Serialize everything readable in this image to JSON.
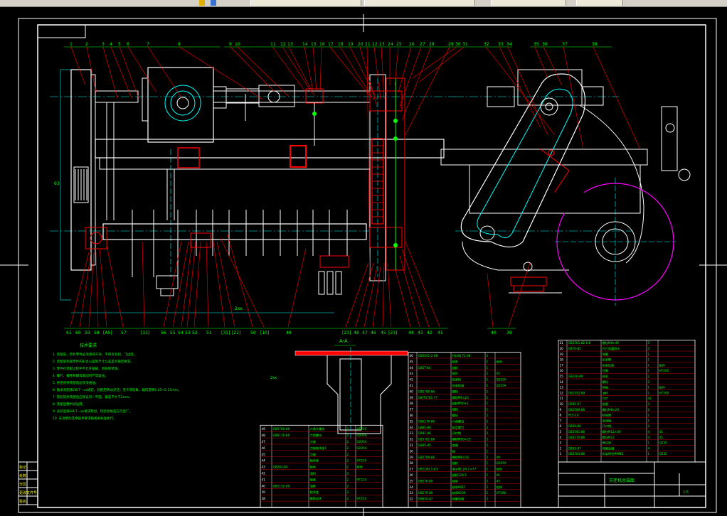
{
  "window": {
    "top_tabs": [
      "",
      "",
      "",
      ""
    ]
  },
  "drawing": {
    "section_label": "A-A",
    "dim_bottom": "2xx",
    "dim_left": "63",
    "dim_mid": "2xx",
    "tech_title": "技术要求",
    "tech_lines": [
      "1. 装配前，所有零件必须清洗干净，不得有毛刺、飞边等。",
      "2. 装配前检查零件的形位公差和尺寸公差是否满足要求。",
      "3. 零件在装配过程中不允许磕碰、划伤和锈蚀。",
      "4. 螺钉、螺栓和螺母紧固时严禁敲击。",
      "5. 各密封件装配前必须浸透油。",
      "6. 轴承装配按GB/T—xx规定，装配后转动灵活，无卡滞现象，轴向游隙0.05~0.15mm。",
      "7. 链轮链条装配后应保证同一平面，偏差不大于2mm。",
      "8. 装配后整机试运转。",
      "9. 总装后按GB/T—xx要求检验，检验合格后方可出厂。",
      "10. 未注明的其余技术要求按相关标准执行。"
    ],
    "top_labels": [
      "1",
      "2",
      "3",
      "4",
      "5",
      "6",
      "7",
      "8",
      "9",
      "10",
      "11",
      "12",
      "13",
      "14",
      "15",
      "16",
      "17",
      "18",
      "19",
      "20",
      "21",
      "22",
      "23",
      "24",
      "25",
      "26",
      "27",
      "28",
      "29",
      "30",
      "31",
      "32",
      "33",
      "34",
      "35",
      "36",
      "37",
      "38"
    ],
    "bottom_labels": [
      "61",
      "60",
      "59",
      "58",
      "[A5]",
      "57",
      "[11]",
      "56",
      "55",
      "54",
      "53",
      "52",
      "51",
      "[31]",
      "[21]",
      "50",
      "[10]",
      "49",
      "[23]",
      "48",
      "47",
      "46",
      "45",
      "[23]",
      "44",
      "43",
      "42",
      "41",
      "40",
      "39"
    ],
    "title_block": {
      "name": "灭茬机总装图",
      "scale": "1:5"
    },
    "bom_left": [
      {
        "no": "49",
        "code": "GB5780-86",
        "name": "六角头螺栓",
        "qty": "2",
        "mat": "HT210"
      },
      {
        "no": "48",
        "code": "GB6170-86",
        "name": "六角螺母",
        "qty": "2",
        "mat": "Q235A"
      },
      {
        "no": "47",
        "code": "",
        "name": "刀座",
        "qty": "2",
        "mat": "Q235A"
      },
      {
        "no": "46",
        "code": "",
        "name": "刀轴轴承座1",
        "qty": "2",
        "mat": "Q235A"
      },
      {
        "no": "45",
        "code": "",
        "name": "刀轴",
        "qty": "2",
        "mat": ""
      },
      {
        "no": "44",
        "code": "",
        "name": "轴承座",
        "qty": "2",
        "mat": "HT210"
      },
      {
        "no": "43",
        "code": "GB281-84",
        "name": "轴承",
        "qty": "2",
        "mat": "组件"
      },
      {
        "no": "42",
        "code": "",
        "name": "油封",
        "qty": "2",
        "mat": ""
      },
      {
        "no": "41",
        "code": "",
        "name": "端盖",
        "qty": "2",
        "mat": "HT210"
      },
      {
        "no": "40",
        "code": "GB1152-89",
        "name": "油杯",
        "qty": "2",
        "mat": ""
      },
      {
        "no": "39",
        "code": "",
        "name": "轴承盖",
        "qty": "2",
        "mat": ""
      },
      {
        "no": "38",
        "code": "",
        "name": "螺栓组件",
        "qty": "2",
        "mat": "HT210"
      }
    ],
    "bom_mid": [
      {
        "no": "46",
        "code": "GB5871-2-88",
        "name": "开口销 72:88",
        "qty": "2",
        "mat": ""
      },
      {
        "no": "45",
        "code": "",
        "name": "链条",
        "qty": "1",
        "mat": "组件"
      },
      {
        "no": "44",
        "code": "GB5T-84",
        "name": "链轮",
        "qty": "1",
        "mat": ""
      },
      {
        "no": "43",
        "code": "",
        "name": "垫片",
        "qty": "2",
        "mat": "45"
      },
      {
        "no": "42",
        "code": "",
        "name": "张紧轮",
        "qty": "1",
        "mat": "Q235A"
      },
      {
        "no": "41",
        "code": "",
        "name": "张紧轮轴",
        "qty": "1",
        "mat": "Q235A"
      },
      {
        "no": "40",
        "code": "GB5780-86",
        "name": "螺栓",
        "qty": "2",
        "mat": ""
      },
      {
        "no": "39",
        "code": "GB/T5781-77",
        "name": "螺栓M6×25",
        "qty": "2",
        "mat": ""
      },
      {
        "no": "38",
        "code": "",
        "name": "链轮M10×1",
        "qty": "1",
        "mat": ""
      },
      {
        "no": "37",
        "code": "",
        "name": "链轮",
        "qty": "1",
        "mat": ""
      },
      {
        "no": "36",
        "code": "",
        "name": "螺母",
        "qty": "2",
        "mat": ""
      },
      {
        "no": "35",
        "code": "GB6170-86",
        "name": "六角螺母",
        "qty": "2",
        "mat": ""
      },
      {
        "no": "34",
        "code": "GB85-88",
        "name": "紧定螺钉",
        "qty": "2",
        "mat": ""
      },
      {
        "no": "33",
        "code": "GB91-86",
        "name": "开口销",
        "qty": "2",
        "mat": ""
      },
      {
        "no": "32",
        "code": "GB5781-86",
        "name": "螺栓M10×25",
        "qty": "2",
        "mat": ""
      },
      {
        "no": "31",
        "code": "GB95-85",
        "name": "垫圈",
        "qty": "2",
        "mat": ""
      },
      {
        "no": "30",
        "code": "",
        "name": "轴",
        "qty": "1",
        "mat": ""
      },
      {
        "no": "29",
        "code": "GB5780-86",
        "name": "螺栓M8×16",
        "qty": "2",
        "mat": "40"
      },
      {
        "no": "28",
        "code": "",
        "name": "链轮",
        "qty": "1",
        "mat": "Q235A"
      },
      {
        "no": "27",
        "code": "GB1243.1-83",
        "name": "滚子链12A-1×77",
        "qty": "1",
        "mat": "组件"
      },
      {
        "no": "26",
        "code": "",
        "name": "链轮12A-1",
        "qty": "1",
        "mat": "45"
      },
      {
        "no": "25",
        "code": "GB276-89",
        "name": "轴承",
        "qty": "2",
        "mat": "45"
      },
      {
        "no": "24",
        "code": "",
        "name": "轴承6017",
        "qty": "2",
        "mat": "组件"
      },
      {
        "no": "23",
        "code": "GB276-89",
        "name": "轴承6206",
        "qty": "2",
        "mat": "HT200"
      },
      {
        "no": "22",
        "code": "GB859-87",
        "name": "弹簧垫圈",
        "qty": "2",
        "mat": ""
      }
    ],
    "bom_right": [
      {
        "no": "21",
        "code": "GB5781-82 8.8",
        "name": "螺栓M8×40",
        "qty": "2",
        "mat": ""
      },
      {
        "no": "20",
        "code": "GB70-85",
        "name": "内六角圆柱头",
        "qty": "2",
        "mat": ""
      },
      {
        "no": "19",
        "code": "",
        "name": "弹簧",
        "qty": "1",
        "mat": ""
      },
      {
        "no": "18",
        "code": "",
        "name": "张紧臂",
        "qty": "1",
        "mat": ""
      },
      {
        "no": "17",
        "code": "",
        "name": "张紧轮座",
        "qty": "1",
        "mat": "组件"
      },
      {
        "no": "16",
        "code": "",
        "name": "挡圈",
        "qty": "1",
        "mat": "HT200"
      },
      {
        "no": "15",
        "code": "GB276-89",
        "name": "轴承",
        "qty": "2",
        "mat": ""
      },
      {
        "no": "14",
        "code": "",
        "name": "螺栓",
        "qty": "2",
        "mat": ""
      },
      {
        "no": "13",
        "code": "",
        "name": "销轴",
        "qty": "1",
        "mat": "组件"
      },
      {
        "no": "12",
        "code": "GB1152-89",
        "name": "油杯",
        "qty": "1",
        "mat": "HT200"
      },
      {
        "no": "11",
        "code": "",
        "name": "刀片",
        "qty": "42",
        "mat": ""
      },
      {
        "no": "10",
        "code": "GB95-87",
        "name": "垫圈",
        "qty": "2",
        "mat": ""
      },
      {
        "no": "9",
        "code": "GB5780-86",
        "name": "螺栓M8×20",
        "qty": "2",
        "mat": ""
      },
      {
        "no": "8",
        "code": "HL5-10",
        "name": "联轴器",
        "qty": "1",
        "mat": ""
      },
      {
        "no": "7",
        "code": "",
        "name": "变速箱",
        "qty": "1",
        "mat": ""
      },
      {
        "no": "6",
        "code": "GB91-86",
        "name": "开口销",
        "qty": "2",
        "mat": ""
      },
      {
        "no": "5",
        "code": "GB5781-86",
        "name": "螺栓M12×30",
        "qty": "4",
        "mat": "45"
      },
      {
        "no": "4",
        "code": "GB6170-86",
        "name": "螺母M12",
        "qty": "4",
        "mat": "45"
      },
      {
        "no": "3",
        "code": "",
        "name": "悬挂架",
        "qty": "1",
        "mat": "Q235"
      },
      {
        "no": "2",
        "code": "GB93-87",
        "name": "弹簧垫圈",
        "qty": "4",
        "mat": ""
      },
      {
        "no": "1",
        "code": "GB5783-86",
        "name": "机架焊合件M45",
        "qty": "1",
        "mat": "Q235"
      }
    ],
    "revision_labels": [
      "标记",
      "处数",
      "分区",
      "更改文件号",
      "签名"
    ]
  }
}
